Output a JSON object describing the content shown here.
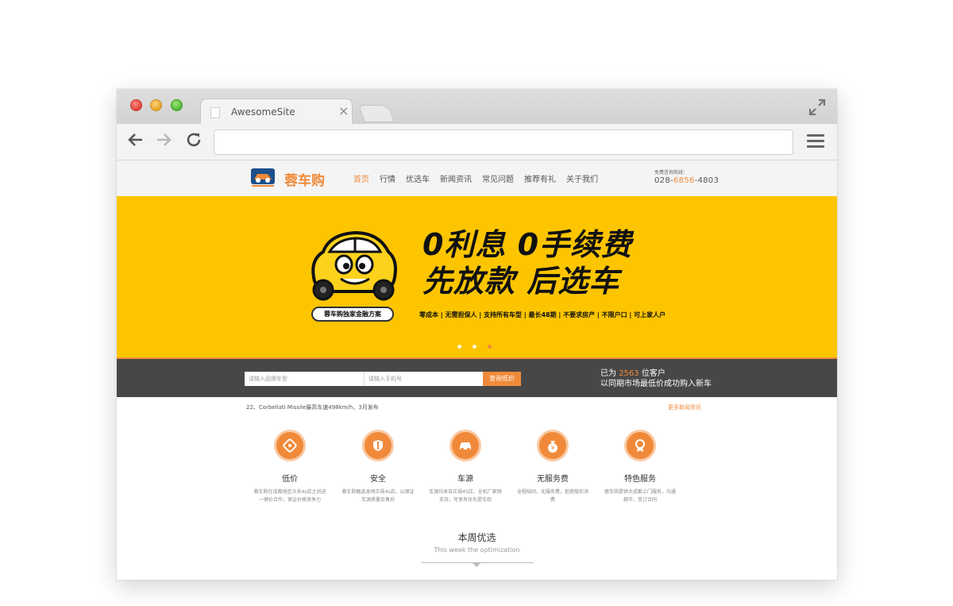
{
  "browser": {
    "tab_title": "AwesomeSite",
    "tab_close": "×",
    "icons": {
      "back": "arrow-left-icon",
      "forward": "arrow-right-icon",
      "reload": "reload-icon",
      "menu": "hamburger-menu-icon",
      "expand": "expand-icon"
    },
    "url": ""
  },
  "header": {
    "logo_text": "蓉车购",
    "nav": [
      {
        "label": "首页",
        "active": true
      },
      {
        "label": "行情"
      },
      {
        "label": "优选车"
      },
      {
        "label": "新闻资讯"
      },
      {
        "label": "常见问题"
      },
      {
        "label": "推荐有礼"
      },
      {
        "label": "关于我们"
      }
    ],
    "hotline_label": "免费咨询热线：",
    "hotline_prefix": "028-",
    "hotline_mid": "6856",
    "hotline_suffix": "-4803"
  },
  "banner": {
    "headline_line1": "0利息 0手续费",
    "headline_line2": "先放款 后选车",
    "pill_label": "蓉车购独家金融方案",
    "features": "零成本 | 无需担保人 | 支持所有车型 | 最长48期 | 不要求房产 | 不限户口 | 可上家人户",
    "active_slide": 3,
    "slide_count": 3
  },
  "search": {
    "brand_placeholder": "请输入品牌车型",
    "phone_placeholder": "请输入手机号",
    "button_label": "查询低价",
    "served_prefix": "已为 ",
    "served_count": "2563",
    "served_suffix": " 位客户",
    "served_line2": "以同期市场最低价成功购入新车"
  },
  "news": {
    "headline": "22、Corbellati Missile最高车速498km/h，3月发布",
    "more_label": "更多新闻资讯"
  },
  "features": [
    {
      "icon": "price-tag-icon",
      "title": "低价",
      "desc": "蓉车购在成都地区众多4s店之间进一俩价合作，保证价格竞争力"
    },
    {
      "icon": "shield-icon",
      "title": "安全",
      "desc": "蓉车购甄选本地正规4s店，以保证车源质量及售后"
    },
    {
      "icon": "car-icon",
      "title": "车源",
      "desc": "车源均来自正规4S店，全机厂家频支持，可享有优先提车权"
    },
    {
      "icon": "money-bag-icon",
      "title": "无服务费",
      "desc": "全程陪同，无服务费，拒绝隐形消费"
    },
    {
      "icon": "medal-icon",
      "title": "特色服务",
      "desc": "蓉车购提供大成都上门服务，沟通细节，签订合同"
    }
  ],
  "week": {
    "title": "本周优选",
    "subtitle": "This week the optimization"
  },
  "colors": {
    "accent": "#f08a3a",
    "banner": "#fdc500",
    "strip": "#474747"
  }
}
